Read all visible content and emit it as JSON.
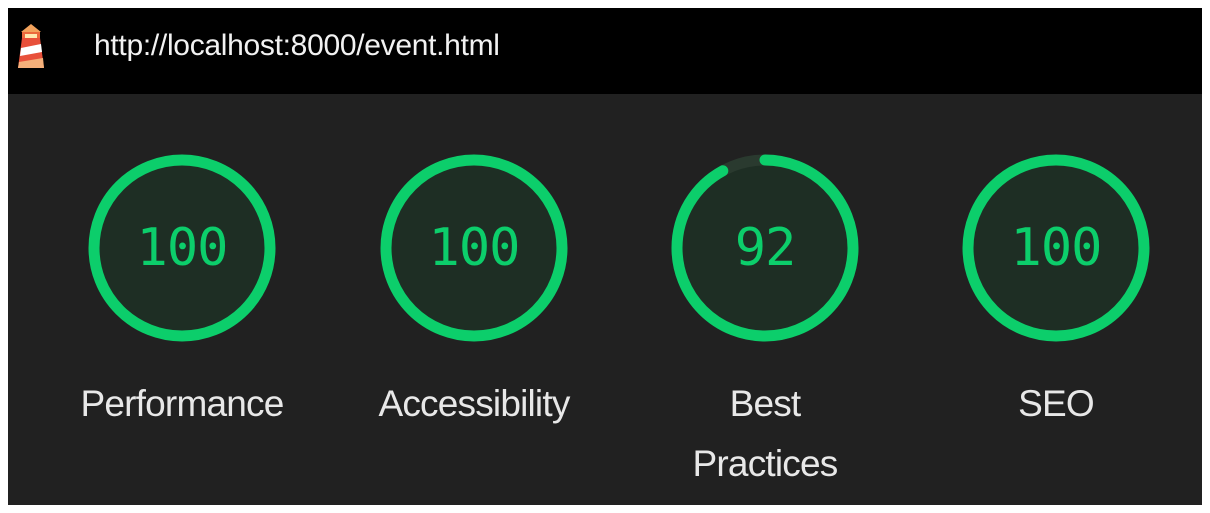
{
  "header": {
    "url": "http://localhost:8000/event.html",
    "logo_icon": "lighthouse-icon"
  },
  "colors": {
    "pass": "#0cce6b",
    "pass_fill": "#1e2e24",
    "track": "#2a3a2f",
    "background": "#212121",
    "header_bg": "#000000"
  },
  "categories": [
    {
      "name": "Performance",
      "score": 100,
      "label": "Performance"
    },
    {
      "name": "Accessibility",
      "score": 100,
      "label": "Accessibility"
    },
    {
      "name": "Best Practices",
      "score": 92,
      "label_line1": "Best",
      "label_line2": "Practices"
    },
    {
      "name": "SEO",
      "score": 100,
      "label": "SEO"
    }
  ]
}
